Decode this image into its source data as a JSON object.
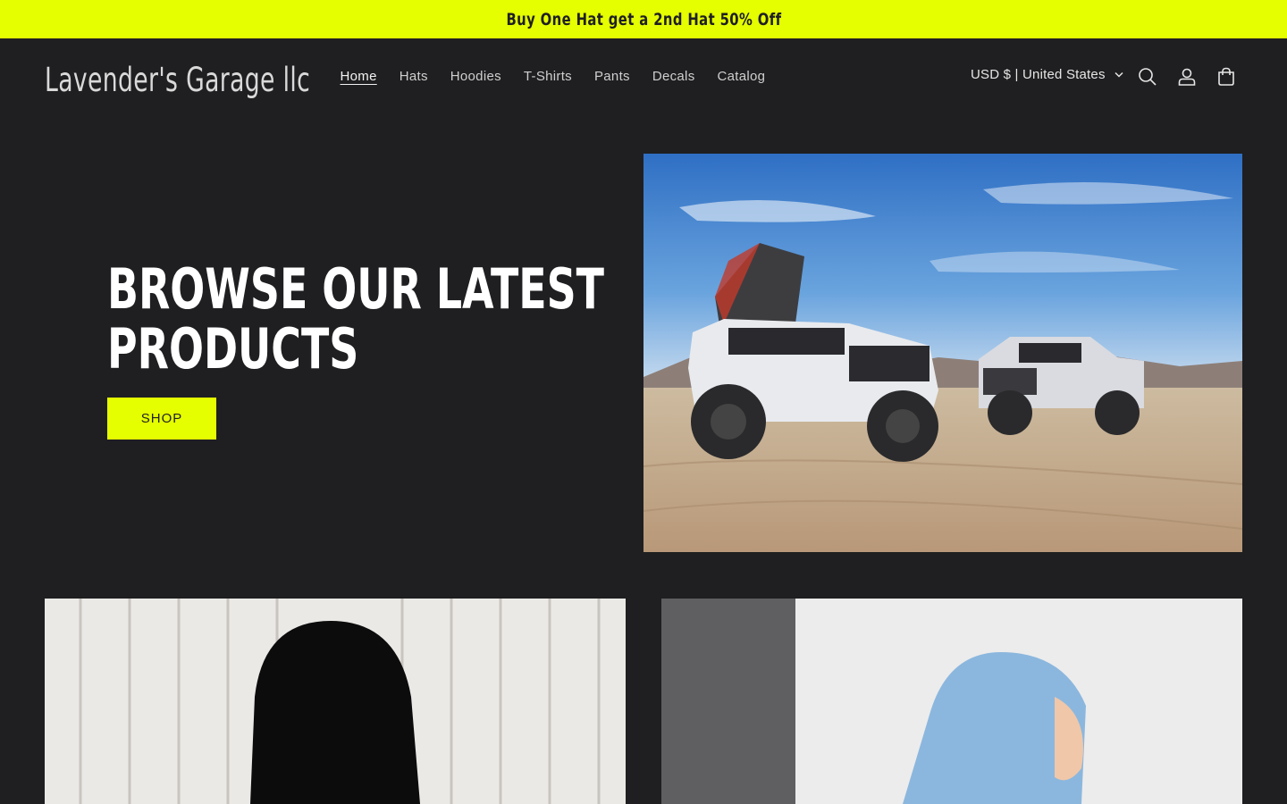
{
  "announcement": {
    "text": "Buy One Hat get a 2nd Hat 50% Off"
  },
  "header": {
    "logo": "Lavender's Garage llc",
    "nav": [
      {
        "label": "Home",
        "active": true
      },
      {
        "label": "Hats"
      },
      {
        "label": "Hoodies"
      },
      {
        "label": "T-Shirts"
      },
      {
        "label": "Pants"
      },
      {
        "label": "Decals"
      },
      {
        "label": "Catalog"
      }
    ],
    "currency": "USD $ | United States"
  },
  "hero": {
    "title_line1": "Browse our latest",
    "title_line2": "products",
    "button": "SHOP"
  },
  "colors": {
    "accent": "#e5ff00",
    "background": "#1f1f21",
    "text": "#ffffff"
  },
  "icons": {
    "search": "search-icon",
    "account": "account-icon",
    "cart": "cart-icon",
    "currency_chevron": "chevron-down-icon"
  }
}
